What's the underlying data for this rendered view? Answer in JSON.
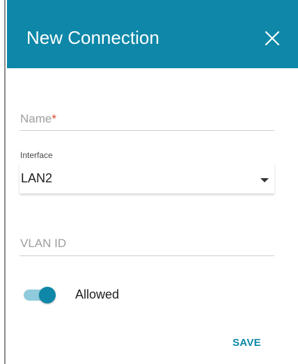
{
  "dialog": {
    "title": "New Connection",
    "close_icon": "close-icon",
    "accent_color": "#0e87a8"
  },
  "form": {
    "name": {
      "label": "Name",
      "required_mark": "*",
      "value": ""
    },
    "interface": {
      "label": "Interface",
      "selected": "LAN2",
      "caret_icon": "caret-down-icon"
    },
    "vlan_id": {
      "label": "VLAN ID",
      "value": ""
    },
    "toggle": {
      "label": "Allowed",
      "on": true
    }
  },
  "actions": {
    "save_label": "SAVE"
  }
}
